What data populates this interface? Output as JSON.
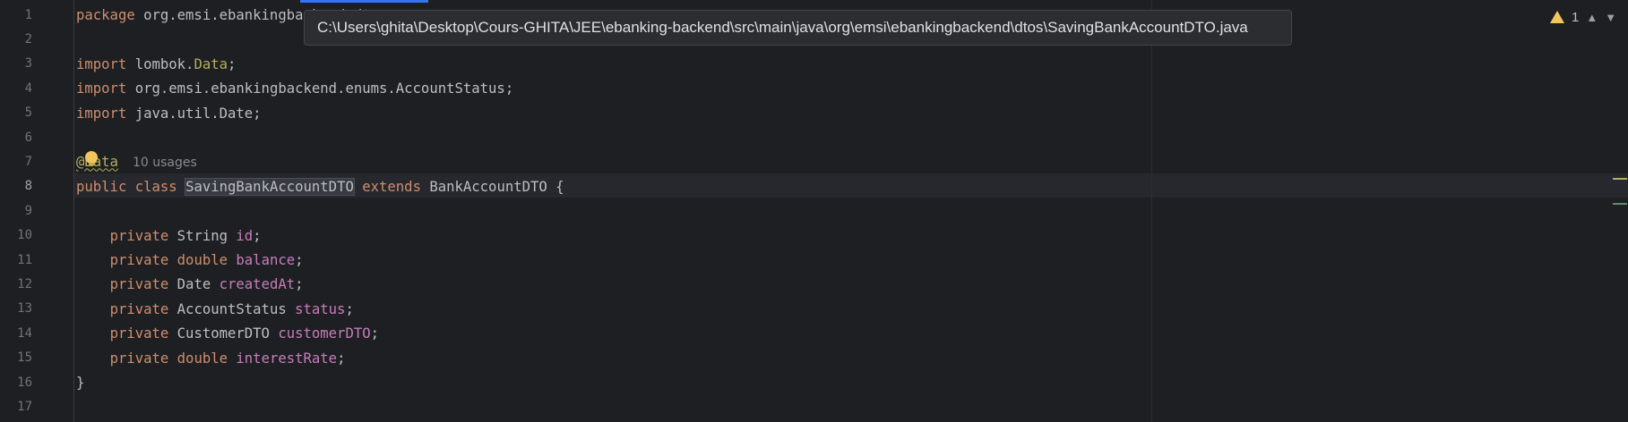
{
  "tooltip": {
    "path": "C:\\Users\\ghita\\Desktop\\Cours-GHITA\\JEE\\ebanking-backend\\src\\main\\java\\org\\emsi\\ebankingbackend\\dtos\\SavingBankAccountDTO.java"
  },
  "inspections": {
    "warning_count": "1",
    "up_icon": "chevron-up-icon",
    "down_icon": "chevron-down-icon"
  },
  "colors": {
    "keyword": "#cf8e6d",
    "annotation": "#b3ae60",
    "field": "#c77dbb",
    "text": "#bcbec4",
    "background": "#1e1f22",
    "warning": "#f2c55c"
  },
  "gutter": {
    "line_numbers": [
      "1",
      "2",
      "3",
      "4",
      "5",
      "6",
      "7",
      "8",
      "9",
      "10",
      "11",
      "12",
      "13",
      "14",
      "15",
      "16",
      "17"
    ],
    "current_line": "8"
  },
  "code": {
    "l1": {
      "kw": "package",
      "rest": " org.emsi.ebankingbackend.dtos;"
    },
    "l3": {
      "kw": "import",
      "pre": " lombok.",
      "ann": "Data",
      "post": ";"
    },
    "l4": {
      "kw": "import",
      "rest": " org.emsi.ebankingbackend.enums.AccountStatus;"
    },
    "l5": {
      "kw": "import",
      "rest": " java.util.Date;"
    },
    "l7": {
      "annotation": "@Data",
      "usages": "10 usages"
    },
    "l8": {
      "kw1": "public",
      "kw2": "class",
      "class_name": "SavingBankAccountDTO",
      "kw3": "extends",
      "parent": "BankAccountDTO",
      "brace": " {"
    },
    "l10": {
      "kw": "private",
      "type": " String ",
      "field": "id",
      "semi": ";"
    },
    "l11": {
      "kw": "private",
      "type": "double",
      "field": "balance",
      "semi": ";"
    },
    "l12": {
      "kw": "private",
      "type": " Date ",
      "field": "createdAt",
      "semi": ";"
    },
    "l13": {
      "kw": "private",
      "type": " AccountStatus ",
      "field": "status",
      "semi": ";"
    },
    "l14": {
      "kw": "private",
      "type": " CustomerDTO ",
      "field": "customerDTO",
      "semi": ";"
    },
    "l15": {
      "kw": "private",
      "type": "double",
      "field": "interestRate",
      "semi": ";"
    },
    "l16": {
      "brace": "}"
    }
  }
}
